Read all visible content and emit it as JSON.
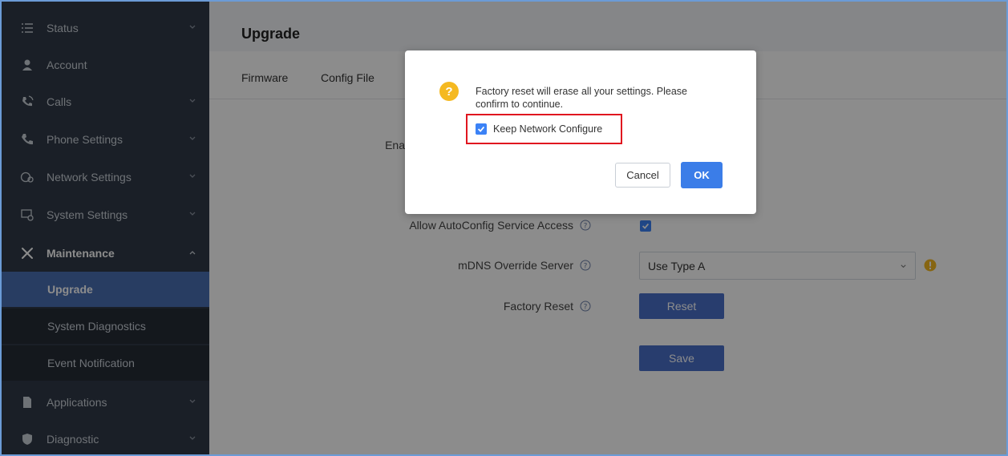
{
  "sidebar": {
    "items": [
      {
        "label": "Status",
        "icon": "list-icon"
      },
      {
        "label": "Account",
        "icon": "user-icon"
      },
      {
        "label": "Calls",
        "icon": "phone-call-icon"
      },
      {
        "label": "Phone Settings",
        "icon": "phone-icon"
      },
      {
        "label": "Network Settings",
        "icon": "network-icon"
      },
      {
        "label": "System Settings",
        "icon": "monitor-gear-icon"
      },
      {
        "label": "Maintenance",
        "icon": "tools-icon"
      },
      {
        "label": "Applications",
        "icon": "document-icon"
      },
      {
        "label": "Diagnostic",
        "icon": "shield-icon"
      }
    ],
    "maintenance_sub": [
      {
        "label": "Upgrade"
      },
      {
        "label": "System Diagnostics"
      },
      {
        "label": "Event Notification"
      }
    ]
  },
  "header": {
    "title": "Upgrade"
  },
  "tabs": [
    {
      "label": "Firmware"
    },
    {
      "label": "Config File"
    }
  ],
  "form": {
    "partial_label": "Ena",
    "autoconfig_label": "Allow AutoConfig Service Access",
    "mdns_label": "mDNS Override Server",
    "mdns_value": "Use Type A",
    "factory_reset_label": "Factory Reset",
    "reset_button": "Reset",
    "save_button": "Save"
  },
  "dialog": {
    "message": "Factory reset will erase all your settings. Please confirm to continue.",
    "checkbox_label": "Keep Network Configure",
    "cancel_label": "Cancel",
    "ok_label": "OK"
  },
  "colors": {
    "sidebar_bg": "#313a47",
    "active_item": "#4a6fb3",
    "accent": "#3b7de8",
    "highlight_border": "#e0161f",
    "warning": "#f5b921"
  }
}
